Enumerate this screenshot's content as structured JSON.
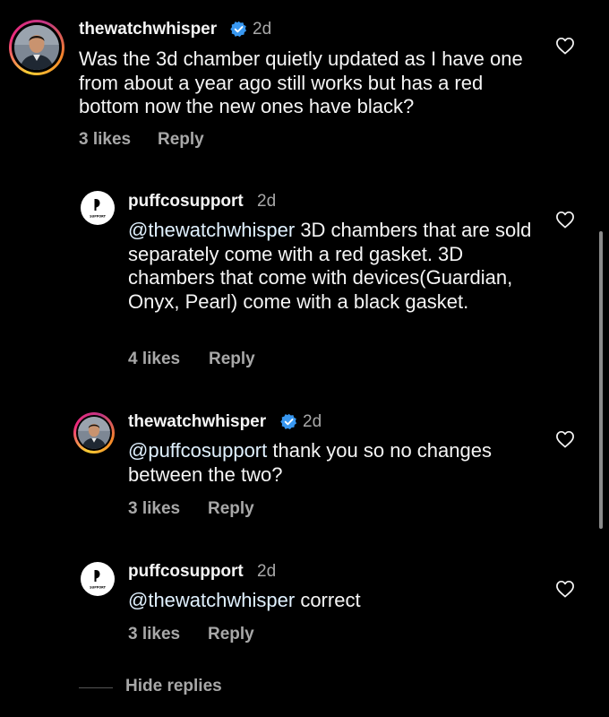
{
  "comments": [
    {
      "username": "thewatchwhisper",
      "verified": true,
      "age": "2d",
      "text": "Was the 3d chamber quietly updated as I have one from about a year ago still works but has a red bottom now the new ones have black?",
      "mention": "",
      "likes": "3 likes",
      "reply": "Reply"
    },
    {
      "username": "puffcosupport",
      "verified": false,
      "age": "2d",
      "mention": "@thewatchwhisper",
      "text": " 3D chambers that are sold separately come with a red gasket. 3D chambers that come with devices(Guardian, Onyx, Pearl) come with a black gasket.",
      "likes": "4 likes",
      "reply": "Reply",
      "logo_text": "SUPPORT"
    },
    {
      "username": "thewatchwhisper",
      "verified": true,
      "age": "2d",
      "mention": "@puffcosupport",
      "text": " thank you so no changes between the two?",
      "likes": "3 likes",
      "reply": "Reply"
    },
    {
      "username": "puffcosupport",
      "verified": false,
      "age": "2d",
      "mention": "@thewatchwhisper",
      "text": " correct",
      "likes": "3 likes",
      "reply": "Reply",
      "logo_text": "SUPPORT"
    }
  ],
  "hide_replies": "Hide replies",
  "colors": {
    "background": "#000000",
    "text": "#f5f5f5",
    "secondary": "#a8a8a8",
    "verified": "#3897f0"
  },
  "icons": [
    "verified-badge-icon",
    "heart-icon"
  ]
}
